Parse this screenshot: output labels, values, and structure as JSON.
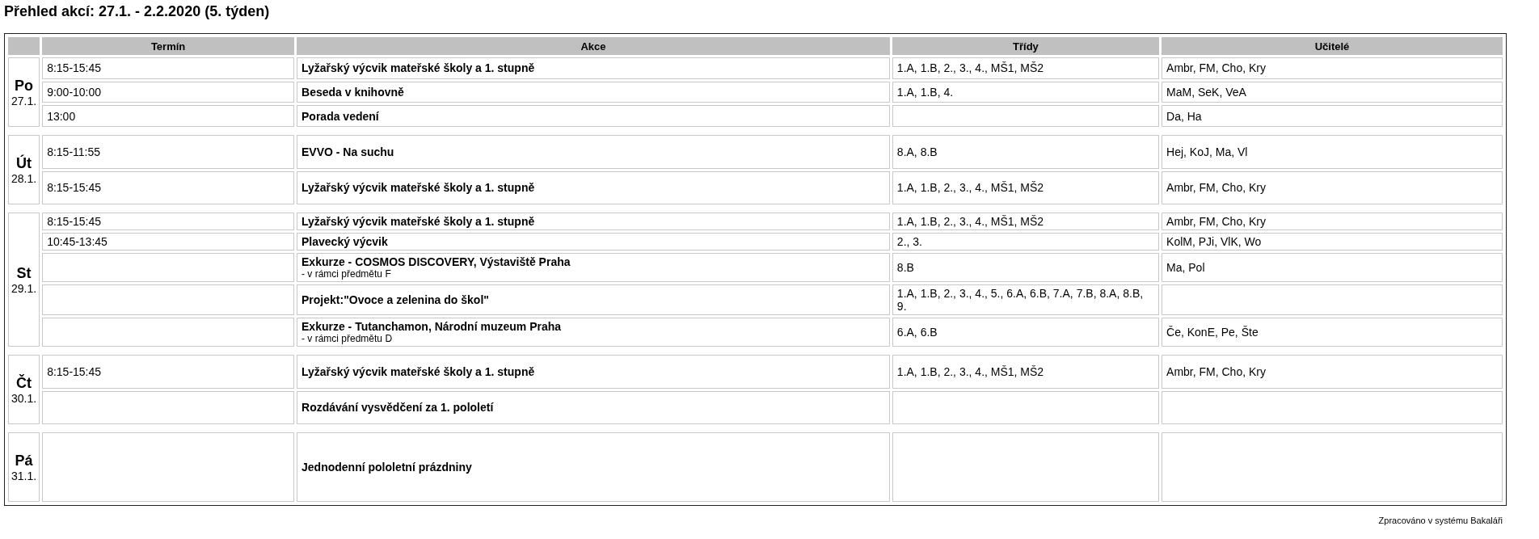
{
  "title": "Přehled akcí: 27.1. - 2.2.2020 (5. týden)",
  "columns": [
    "Termín",
    "Akce",
    "Třídy",
    "Učitelé"
  ],
  "days": [
    {
      "day": "Po",
      "date": "27.1.",
      "events": [
        {
          "time": "8:15-15:45",
          "action": "Lyžařský výcvik mateřské školy a 1. stupně",
          "classes": "1.A, 1.B, 2., 3., 4., MŠ1, MŠ2",
          "teachers": "Ambr, FM, Cho, Kry"
        },
        {
          "time": "9:00-10:00",
          "action": "Beseda v knihovně",
          "classes": "1.A, 1.B, 4.",
          "teachers": "MaM, SeK, VeA"
        },
        {
          "time": "13:00",
          "action": "Porada vedení",
          "teachers": "Da, Ha"
        }
      ]
    },
    {
      "day": "Út",
      "date": "28.1.",
      "events": [
        {
          "time": "8:15-11:55",
          "action": "EVVO - Na suchu",
          "classes": "8.A, 8.B",
          "teachers": "Hej, KoJ, Ma, Vl"
        },
        {
          "time": "8:15-15:45",
          "action": "Lyžařský výcvik mateřské školy a 1. stupně",
          "classes": "1.A, 1.B, 2., 3., 4., MŠ1, MŠ2",
          "teachers": "Ambr, FM, Cho, Kry"
        }
      ]
    },
    {
      "day": "St",
      "date": "29.1.",
      "events": [
        {
          "time": "8:15-15:45",
          "action": "Lyžařský výcvik mateřské školy a 1. stupně",
          "classes": "1.A, 1.B, 2., 3., 4., MŠ1, MŠ2",
          "teachers": "Ambr, FM, Cho, Kry"
        },
        {
          "time": "10:45-13:45",
          "action": "Plavecký výcvik",
          "classes": "2., 3.",
          "teachers": "KolM, PJi, VlK, Wo"
        },
        {
          "action": "Exkurze - COSMOS DISCOVERY, Výstaviště Praha",
          "note": "- v rámci předmětu F",
          "classes": "8.B",
          "teachers": "Ma, Pol"
        },
        {
          "action": "Projekt:\"Ovoce a zelenina do škol\"",
          "classes": "1.A, 1.B, 2., 3., 4., 5., 6.A, 6.B, 7.A, 7.B, 8.A, 8.B, 9."
        },
        {
          "action": "Exkurze - Tutanchamon, Národní muzeum Praha",
          "note": "- v rámci předmětu D",
          "classes": "6.A, 6.B",
          "teachers": "Če, KonE, Pe, Šte"
        }
      ]
    },
    {
      "day": "Čt",
      "date": "30.1.",
      "events": [
        {
          "time": "8:15-15:45",
          "action": "Lyžařský výcvik mateřské školy a 1. stupně",
          "classes": "1.A, 1.B, 2., 3., 4., MŠ1, MŠ2",
          "teachers": "Ambr, FM, Cho, Kry"
        },
        {
          "action": "Rozdávání vysvědčení za 1. pololetí"
        }
      ]
    },
    {
      "day": "Pá",
      "date": "31.1.",
      "events": [
        {
          "action": "Jednodenní pololetní prázdniny"
        }
      ]
    }
  ],
  "footer": "Zpracováno v systému Bakaláři"
}
